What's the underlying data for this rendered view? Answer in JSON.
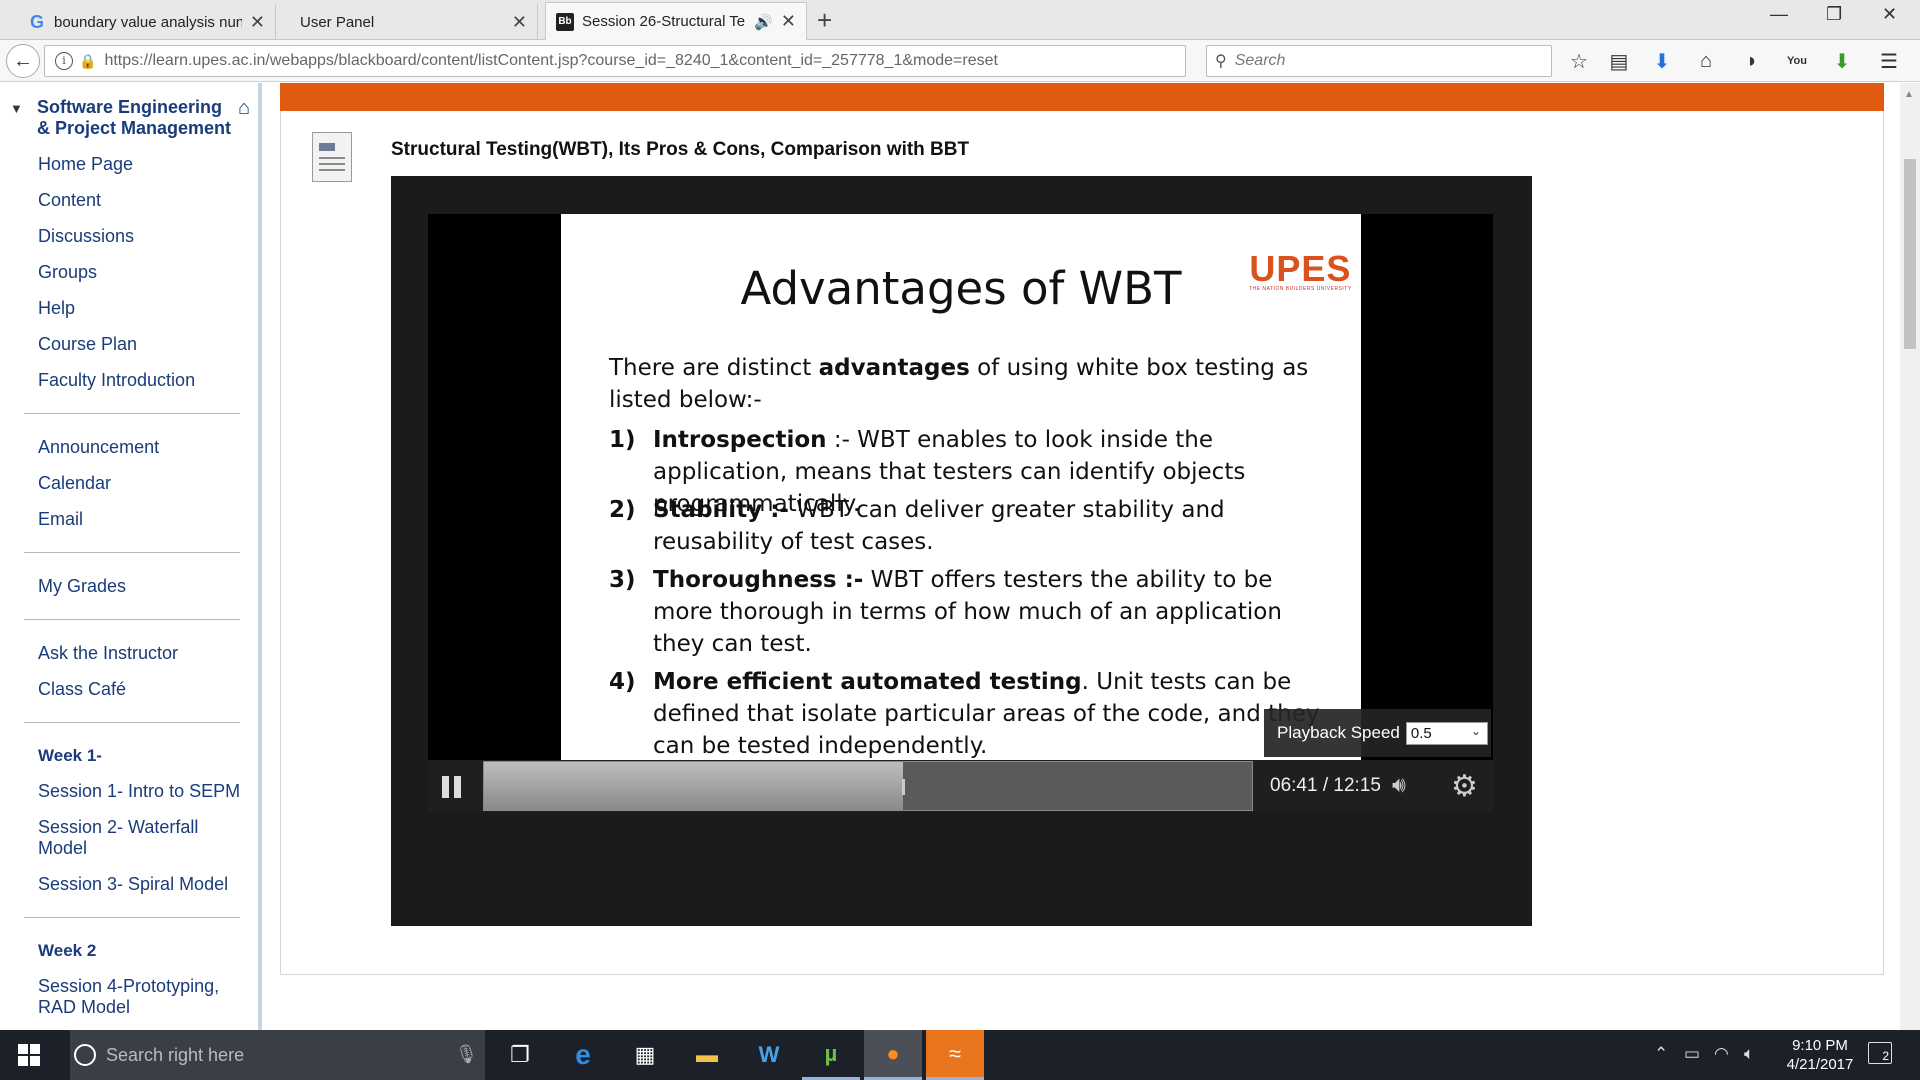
{
  "browser": {
    "tabs": [
      {
        "label": "boundary value analysis nun",
        "favicon": "google-g"
      },
      {
        "label": "User Panel",
        "favicon": "none"
      },
      {
        "label": "Session 26-Structural Te",
        "favicon": "blackboard",
        "active": true
      }
    ],
    "url": "https://learn.upes.ac.in/webapps/blackboard/content/listContent.jsp?course_id=_8240_1&content_id=_257778_1&mode=reset",
    "search_placeholder": "Search"
  },
  "sidebar": {
    "course_title": "Software Engineering & Project Management",
    "group1": [
      "Home Page",
      "Content",
      "Discussions",
      "Groups",
      "Help",
      "Course Plan",
      "Faculty Introduction"
    ],
    "group2": [
      "Announcement",
      "Calendar",
      "Email"
    ],
    "group3": [
      "My Grades"
    ],
    "group4": [
      "Ask the Instructor",
      "Class Café"
    ],
    "week1_heading": "Week 1-",
    "week1_items": [
      "Session 1- Intro to SEPM",
      "Session 2- Waterfall Model",
      "Session 3- Spiral Model"
    ],
    "week2_heading": "Week 2",
    "week2_items": [
      "Session 4-Prototyping, RAD Model"
    ]
  },
  "content": {
    "item_title": "Structural Testing(WBT), Its Pros & Cons, Comparison with BBT",
    "accent_color": "#e05a0f"
  },
  "slide": {
    "title": "Advantages of WBT",
    "logo_text": "UPES",
    "logo_tagline": "THE NATION BUILDERS UNIVERSITY",
    "intro_pre": "There are distinct ",
    "intro_bold": "advantages",
    "intro_post": " of using white box testing as listed below:-",
    "points": [
      {
        "num": "1)",
        "head": "Introspection",
        "text": " :- WBT enables to look inside the application, means that testers can identify objects programmatically."
      },
      {
        "num": "2)",
        "head": "Stability :-",
        "text": " WBT can deliver greater stability and reusability of test cases."
      },
      {
        "num": "3)",
        "head": "Thoroughness :-",
        "text": " WBT offers testers the ability to be more thorough in terms of how much of an application they can test."
      },
      {
        "num": "4)",
        "head": "More efficient automated testing",
        "text": ". Unit tests can be defined that isolate particular areas of the code, and they can be tested independently."
      }
    ]
  },
  "player": {
    "playback_speed_label": "Playback Speed",
    "playback_speed_value": "0.5",
    "time": "06:41 / 12:15",
    "progress_fraction": 0.546,
    "buffered_fraction": 0.18
  },
  "taskbar": {
    "search_placeholder": "Search right here",
    "time": "9:10 PM",
    "date": "4/21/2017",
    "notification_count": "2"
  }
}
